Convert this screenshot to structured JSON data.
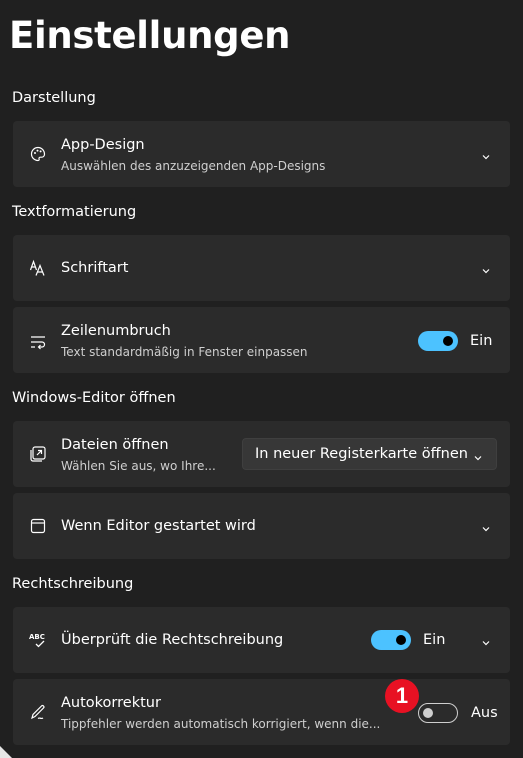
{
  "page": {
    "title": "Einstellungen"
  },
  "sections": {
    "appearance": "Darstellung",
    "text_formatting": "Textformatierung",
    "open_editor": "Windows-Editor öffnen",
    "spelling": "Rechtschreibung"
  },
  "cards": {
    "app_design": {
      "label": "App-Design",
      "sub": "Auswählen des anzuzeigenden App-Designs",
      "icon": "palette-icon"
    },
    "font": {
      "label": "Schriftart",
      "icon": "font-icon"
    },
    "word_wrap": {
      "label": "Zeilenumbruch",
      "sub": "Text standardmäßig in Fenster einpassen",
      "toggle_on": true,
      "state": "Ein",
      "icon": "word-wrap-icon"
    },
    "open_files": {
      "label": "Dateien öffnen",
      "sub": "Wählen Sie aus, wo Ihre...",
      "dropdown_value": "In neuer Registerkarte öffnen",
      "icon": "open-files-icon"
    },
    "on_start": {
      "label": "Wenn Editor gestartet wird",
      "icon": "window-icon"
    },
    "spellcheck": {
      "label": "Überprüft die Rechtschreibung",
      "toggle_on": true,
      "state": "Ein",
      "icon": "spellcheck-icon"
    },
    "autocorrect": {
      "label": "Autokorrektur",
      "sub": "Tippfehler werden automatisch korrigiert, wenn die...",
      "toggle_on": false,
      "state": "Aus",
      "icon": "pen-icon"
    }
  },
  "annotation": {
    "badge": "1"
  },
  "colors": {
    "background": "#202020",
    "card": "#2b2b2b",
    "accent": "#4cc2ff",
    "badge": "#e81123"
  }
}
